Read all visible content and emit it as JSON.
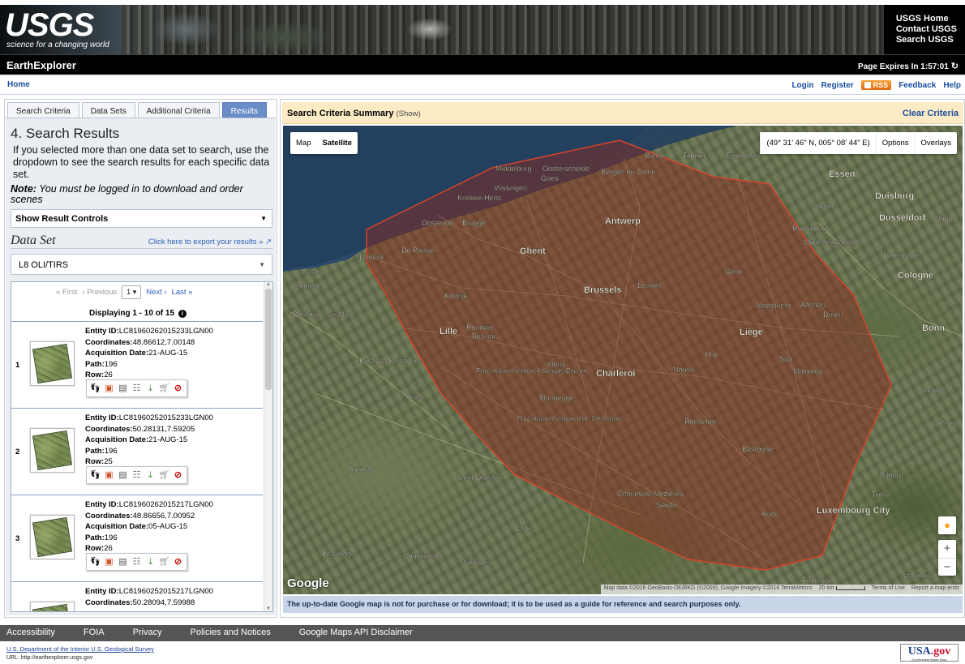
{
  "header": {
    "logo_text": "USGS",
    "logo_tagline": "science for a changing world",
    "top_links": [
      "USGS Home",
      "Contact USGS",
      "Search USGS"
    ]
  },
  "titlebar": {
    "app_name": "EarthExplorer",
    "expires_label": "Page Expires In 1:57:01"
  },
  "navbar": {
    "home": "Home",
    "login": "Login",
    "register": "Register",
    "rss": "RSS",
    "feedback": "Feedback",
    "help": "Help"
  },
  "tabs": [
    {
      "label": "Search Criteria",
      "active": false
    },
    {
      "label": "Data Sets",
      "active": false
    },
    {
      "label": "Additional Criteria",
      "active": false
    },
    {
      "label": "Results",
      "active": true
    }
  ],
  "results_panel": {
    "step_title": "4. Search Results",
    "intro": "If you selected more than one data set to search, use the dropdown to see the search results for each specific data set.",
    "note_label": "Note:",
    "note_text": " You must be logged in to download and order scenes",
    "result_controls": "Show Result Controls",
    "dataset_heading": "Data Set",
    "export_link": "Click here to export your results »",
    "dataset_selected": "L8 OLI/TIRS",
    "pager": {
      "first": "« First",
      "previous": "‹ Previous",
      "page": "1",
      "next": "Next ›",
      "last": "Last »"
    },
    "displaying": "Displaying 1 - 10 of 15"
  },
  "result_labels": {
    "entity": "Entity ID:",
    "coords": "Coordinates:",
    "acq": "Acquisition Date:",
    "path": "Path:",
    "row": "Row:"
  },
  "results": [
    {
      "num": "1",
      "entity_id": "LC81960262015233LGN00",
      "coordinates": "48.86612,7.00148",
      "acq_date": "21-AUG-15",
      "path": "196",
      "row": "26"
    },
    {
      "num": "2",
      "entity_id": "LC81960252015233LGN00",
      "coordinates": "50.28131,7.59205",
      "acq_date": "21-AUG-15",
      "path": "196",
      "row": "25"
    },
    {
      "num": "3",
      "entity_id": "LC81960262015217LGN00",
      "coordinates": "48.86656,7.00952",
      "acq_date": "05-AUG-15",
      "path": "196",
      "row": "26"
    },
    {
      "num": "",
      "entity_id": "LC81960252015217LGN00",
      "coordinates": "50.28094,7.59988",
      "acq_date": "",
      "path": "",
      "row": ""
    }
  ],
  "map": {
    "summary_title": "Search Criteria Summary",
    "summary_show": "(Show)",
    "clear_criteria": "Clear Criteria",
    "type_map": "Map",
    "type_satellite": "Satellite",
    "coords_readout": "(49° 31' 46\" N, 005° 08' 44\" E)",
    "options": "Options",
    "overlays": "Overlays",
    "google_logo": "Google",
    "attribution": "Map data ©2016 GeoBasis-DE/BKG (©2009), Google Imagery ©2016 TerraMetrics",
    "scale_label": "20 km",
    "terms": "Terms of Use",
    "report": "Report a map error",
    "disclaimer": "The up-to-date Google map is not for purchase or for download; it is to be used as a guide for reference and search purposes only.",
    "overlay_fill": "#8a2a1f",
    "overlay_stroke": "#d6442c",
    "places": [
      {
        "name": "Middelburg"
      },
      {
        "name": "Vlissingen"
      },
      {
        "name": "Knokke-Heist"
      },
      {
        "name": "Goes"
      },
      {
        "name": "Bergen op Zoom"
      },
      {
        "name": "Breda"
      },
      {
        "name": "Tilburg"
      },
      {
        "name": "Eindhoven"
      },
      {
        "name": "Oostende"
      },
      {
        "name": "Brugge"
      },
      {
        "name": "Antwerp"
      },
      {
        "name": "Venlo"
      },
      {
        "name": "Essen"
      },
      {
        "name": "Duisburg"
      },
      {
        "name": "Düsseldorf"
      },
      {
        "name": "Wupp"
      },
      {
        "name": "Dunkirk"
      },
      {
        "name": "De Panne"
      },
      {
        "name": "Ghent"
      },
      {
        "name": "Roermond"
      },
      {
        "name": "Mönchengladbach"
      },
      {
        "name": "Leverkusen"
      },
      {
        "name": "Calais"
      },
      {
        "name": "Coquelles"
      },
      {
        "name": "Brussels"
      },
      {
        "name": "Leuven"
      },
      {
        "name": "Genk"
      },
      {
        "name": "Cologne"
      },
      {
        "name": "Kortrijk"
      },
      {
        "name": "Maastricht"
      },
      {
        "name": "Aachen"
      },
      {
        "name": "Düren"
      },
      {
        "name": "Lille"
      },
      {
        "name": "Roubaix"
      },
      {
        "name": "Tournai"
      },
      {
        "name": "Liège"
      },
      {
        "name": "Bonn"
      },
      {
        "name": "Bruay-la-Buissière"
      },
      {
        "name": "Mons"
      },
      {
        "name": "Charleroi"
      },
      {
        "name": "Namur"
      },
      {
        "name": "Huy"
      },
      {
        "name": "Spa"
      },
      {
        "name": "Malmedy"
      },
      {
        "name": "Parc naturel régional Scarpe-Escaut"
      },
      {
        "name": "Maubeuge"
      },
      {
        "name": "Arras"
      },
      {
        "name": "Mayen"
      },
      {
        "name": "Rochefort"
      },
      {
        "name": "Cochem"
      },
      {
        "name": "Parc naturel régional de l'Avesnois"
      },
      {
        "name": "Bastogne"
      },
      {
        "name": "Bitburg"
      },
      {
        "name": "Amiens"
      },
      {
        "name": "Saint-Quentin"
      },
      {
        "name": "Charleville-Mézières"
      },
      {
        "name": "Sedan"
      },
      {
        "name": "Trier"
      },
      {
        "name": "Arlon"
      },
      {
        "name": "Luxembourg City"
      },
      {
        "name": "Laon"
      },
      {
        "name": "Beauvais"
      },
      {
        "name": "Compiègne"
      },
      {
        "name": "Soissons"
      },
      {
        "name": "Thionville"
      },
      {
        "name": "Saarlouis"
      },
      {
        "name": "Oosterschelde"
      },
      {
        "name": "Boulogne-sur-Mer"
      }
    ]
  },
  "footer": {
    "links": [
      "Accessibility",
      "FOIA",
      "Privacy",
      "Policies and Notices",
      "Google Maps API Disclaimer"
    ],
    "doi": "U.S. Department of the Interior",
    "usgs": "U.S. Geological Survey",
    "url": "URL: http://earthexplorer.usgs.gov",
    "usagov": "USA",
    "usagov_suffix": ".gov",
    "usagov_sub": "Government Made Easy"
  }
}
